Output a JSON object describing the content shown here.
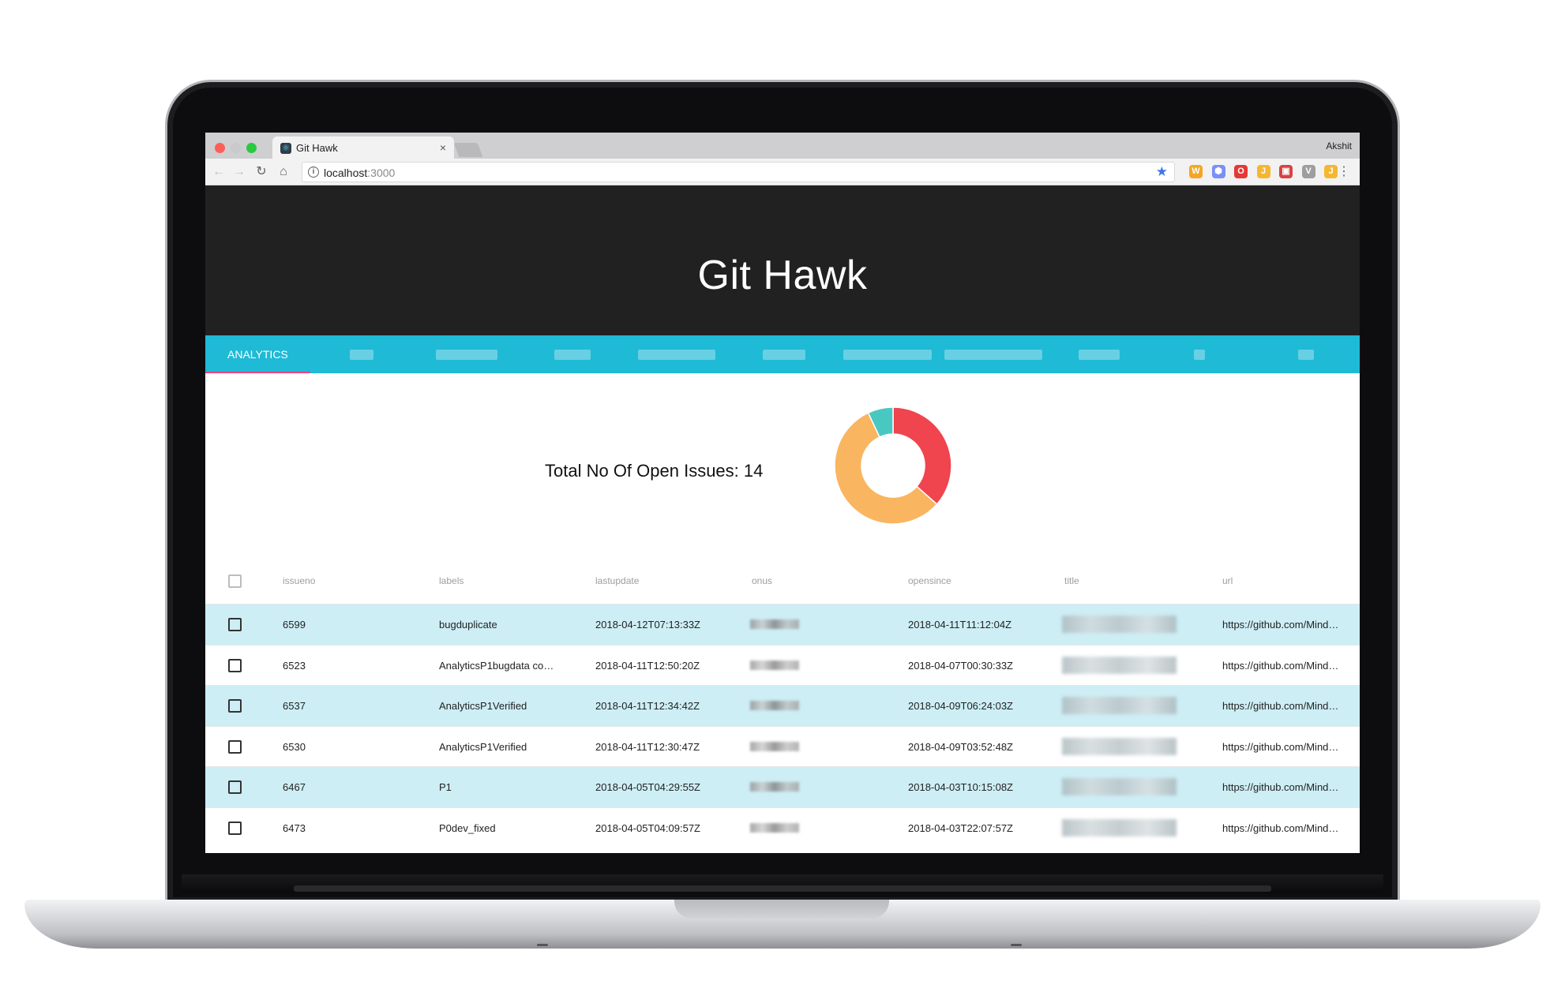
{
  "browser": {
    "tab_title": "Git Hawk",
    "tab_close": "×",
    "profile_name": "Akshit",
    "url_host": "localhost",
    "url_port": ":3000",
    "back_icon": "←",
    "forward_icon": "→",
    "reload_icon": "↻",
    "home_icon": "⌂",
    "info_icon": "i",
    "star_icon": "★",
    "menu_icon": "⋮",
    "extensions": [
      {
        "name": "extension-1-icon",
        "color": "#f5a623",
        "glyph": "W"
      },
      {
        "name": "extension-2-icon",
        "color": "#7b8ff7",
        "glyph": "⬢"
      },
      {
        "name": "opera-icon",
        "color": "#e53935",
        "glyph": "O"
      },
      {
        "name": "extension-4-icon",
        "color": "#f5b731",
        "glyph": "J"
      },
      {
        "name": "extension-5-icon",
        "color": "#d84343",
        "glyph": "▣"
      },
      {
        "name": "vue-devtools-icon",
        "color": "#9e9e9e",
        "glyph": "V"
      },
      {
        "name": "extension-7-icon",
        "color": "#f5b731",
        "glyph": "J"
      }
    ]
  },
  "app": {
    "title": "Git Hawk",
    "tabs": [
      {
        "label": "ANALYTICS",
        "active": true
      }
    ],
    "summary": "Total No Of Open Issues: 14",
    "colors": {
      "header_bg": "#212121",
      "tabs_bg": "#1fbad6",
      "indicator": "#ff4081",
      "row_highlight": "#cdeef5"
    }
  },
  "chart_data": {
    "type": "pie",
    "donut": true,
    "slices": [
      {
        "value": 36.5,
        "color": "#f0444e"
      },
      {
        "value": 56.5,
        "color": "#f9b560"
      },
      {
        "value": 7,
        "color": "#49c8c2"
      }
    ]
  },
  "table": {
    "columns": [
      "issueno",
      "labels",
      "lastupdate",
      "onus",
      "opensince",
      "title",
      "url"
    ],
    "rows": [
      {
        "issueno": "6599",
        "labels": "bugduplicate",
        "lastupdate": "2018-04-12T07:13:33Z",
        "opensince": "2018-04-11T11:12:04Z",
        "url": "https://github.com/Mind…"
      },
      {
        "issueno": "6523",
        "labels": "AnalyticsP1bugdata co…",
        "lastupdate": "2018-04-11T12:50:20Z",
        "opensince": "2018-04-07T00:30:33Z",
        "url": "https://github.com/Mind…"
      },
      {
        "issueno": "6537",
        "labels": "AnalyticsP1Verified",
        "lastupdate": "2018-04-11T12:34:42Z",
        "opensince": "2018-04-09T06:24:03Z",
        "url": "https://github.com/Mind…"
      },
      {
        "issueno": "6530",
        "labels": "AnalyticsP1Verified",
        "lastupdate": "2018-04-11T12:30:47Z",
        "opensince": "2018-04-09T03:52:48Z",
        "url": "https://github.com/Mind…"
      },
      {
        "issueno": "6467",
        "labels": "P1",
        "lastupdate": "2018-04-05T04:29:55Z",
        "opensince": "2018-04-03T10:15:08Z",
        "url": "https://github.com/Mind…"
      },
      {
        "issueno": "6473",
        "labels": "P0dev_fixed",
        "lastupdate": "2018-04-05T04:09:57Z",
        "opensince": "2018-04-03T22:07:57Z",
        "url": "https://github.com/Mind…"
      }
    ]
  }
}
